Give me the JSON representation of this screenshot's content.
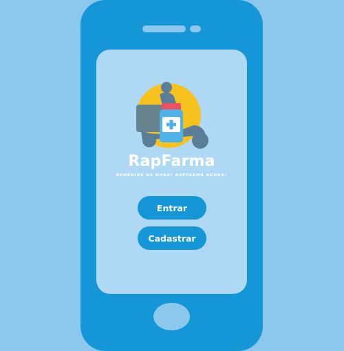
{
  "app": {
    "title": "RapFarma",
    "tagline": "REMÉDIOS NA HORA? RAPFARMA AGORA!"
  },
  "buttons": {
    "login_label": "Entrar",
    "register_label": "Cadastrar"
  },
  "colors": {
    "background": "#8cc8ed",
    "phone_body": "#1596d6",
    "screen": "#aed8f3",
    "logo_circle": "#f7c21d",
    "rider_silhouette": "#5a7e97",
    "bottle_cap": "#ee4f63",
    "bottle_body": "#4fb3e8",
    "button_fill": "#1596d6",
    "text": "#ffffff"
  },
  "icons": {
    "logo": "delivery-scooter-with-medicine-bottle-icon"
  }
}
